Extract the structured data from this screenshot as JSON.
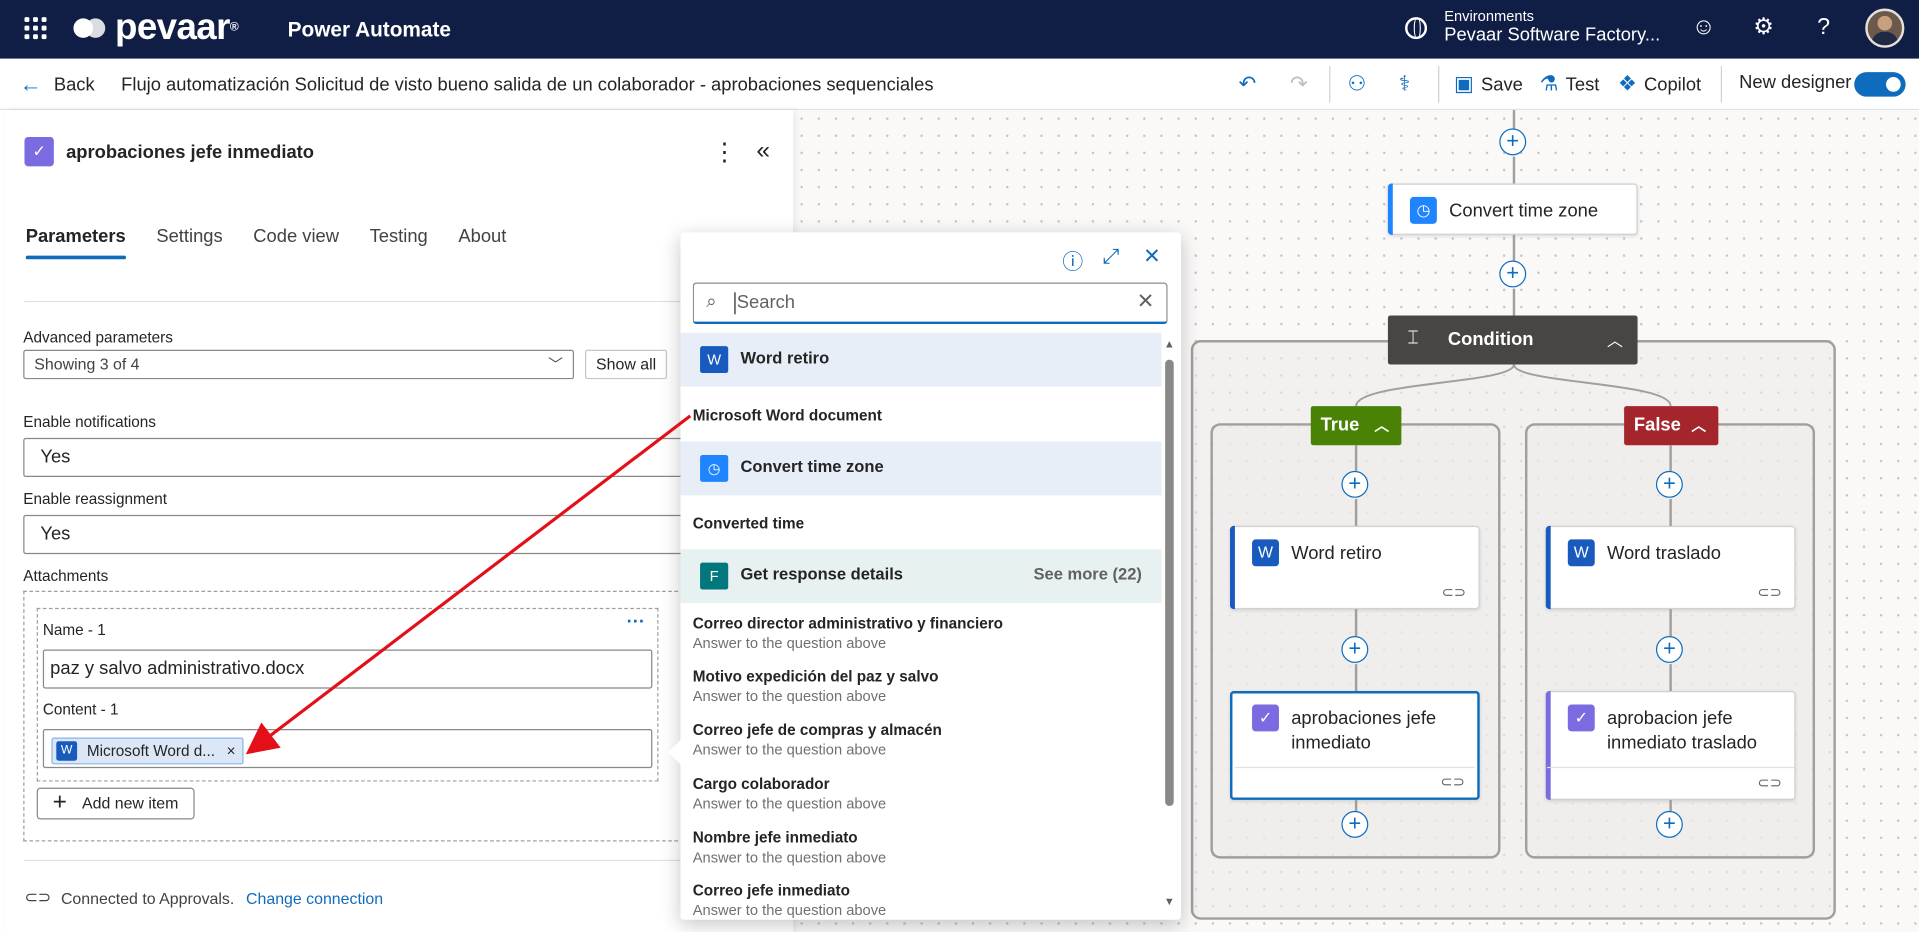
{
  "topbar": {
    "brand": "pevaar",
    "brand_mark": "®",
    "app_name": "Power Automate",
    "environment_label": "Environments",
    "environment_name": "Pevaar Software Factory...",
    "icons": [
      "waffle-icon",
      "globe-icon",
      "smiley-icon",
      "gear-icon",
      "help-icon"
    ]
  },
  "cmdbar": {
    "back_label": "Back",
    "flow_title": "Flujo automatización Solicitud de visto bueno salida de un colaborador - aprobaciones sequenciales",
    "save_label": "Save",
    "test_label": "Test",
    "copilot_label": "Copilot",
    "new_designer_label": "New designer",
    "new_designer_on": true
  },
  "panel": {
    "title": "aprobaciones jefe inmediato",
    "tabs": [
      "Parameters",
      "Settings",
      "Code view",
      "Testing",
      "About"
    ],
    "active_tab": "Parameters",
    "advanced_label": "Advanced parameters",
    "advanced_value": "Showing 3 of 4",
    "show_all": "Show all",
    "enable_notifications_label": "Enable notifications",
    "enable_notifications_value": "Yes",
    "enable_reassignment_label": "Enable reassignment",
    "enable_reassignment_value": "Yes",
    "attachments_label": "Attachments",
    "name_label": "Name - 1",
    "name_value": "paz y salvo administrativo.docx",
    "content_label": "Content - 1",
    "content_token": "Microsoft Word d...",
    "token_close": "×",
    "add_item": "Add new item",
    "item_menu": "···",
    "connected_text": "Connected to Approvals.",
    "change_connection": "Change connection"
  },
  "flyout": {
    "search_placeholder": "Search",
    "groups": [
      {
        "label": "Word retiro",
        "icon": "word-icon",
        "color": "#185abd"
      },
      {
        "label": "Convert time zone",
        "icon": "clock-icon",
        "color": "#1f85ff"
      },
      {
        "label": "Get response details",
        "icon": "forms-icon",
        "color": "#03787c",
        "more": "See more (22)"
      }
    ],
    "group_items": [
      {
        "title": "Microsoft Word document"
      },
      {
        "title": "Converted time"
      }
    ],
    "items": [
      {
        "title": "Correo director administrativo y financiero",
        "desc": "Answer to the question above"
      },
      {
        "title": "Motivo expedición del paz y salvo",
        "desc": "Answer to the question above"
      },
      {
        "title": "Correo jefe de compras y almacén",
        "desc": "Answer to the question above"
      },
      {
        "title": "Cargo colaborador",
        "desc": "Answer to the question above"
      },
      {
        "title": "Nombre jefe inmediato",
        "desc": "Answer to the question above"
      },
      {
        "title": "Correo jefe inmediato",
        "desc": "Answer to the question above"
      }
    ]
  },
  "canvas": {
    "convert_node": "Convert time zone",
    "condition": "Condition",
    "true_label": "True",
    "false_label": "False",
    "true_action": "Word retiro",
    "false_action": "Word traslado",
    "true_approval": "aprobaciones jefe inmediato",
    "false_approval": "aprobacion jefe inmediato traslado",
    "colors": {
      "true": "#498205",
      "false": "#a4262c",
      "word": "#185abd",
      "approval": "#7b6be0",
      "clock": "#1f85ff"
    }
  }
}
